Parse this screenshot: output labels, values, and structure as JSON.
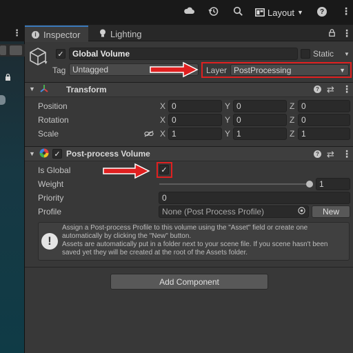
{
  "toolbar": {
    "layout_label": "Layout"
  },
  "tabs": {
    "inspector": "Inspector",
    "lighting": "Lighting"
  },
  "object": {
    "name": "Global Volume",
    "static_label": "Static",
    "tag_label": "Tag",
    "tag_value": "Untagged",
    "layer_label": "Layer",
    "layer_value": "PostProcessing"
  },
  "transform": {
    "title": "Transform",
    "position_label": "Position",
    "rotation_label": "Rotation",
    "scale_label": "Scale",
    "position": {
      "x": "0",
      "y": "0",
      "z": "0"
    },
    "rotation": {
      "x": "0",
      "y": "0",
      "z": "0"
    },
    "scale": {
      "x": "1",
      "y": "1",
      "z": "1"
    },
    "axes": {
      "x": "X",
      "y": "Y",
      "z": "Z"
    }
  },
  "ppv": {
    "title": "Post-process Volume",
    "is_global_label": "Is Global",
    "weight_label": "Weight",
    "weight_value": "1",
    "priority_label": "Priority",
    "priority_value": "0",
    "profile_label": "Profile",
    "profile_value": "None (Post Process Profile)",
    "new_label": "New",
    "help_line1": "Assign a Post-process Profile to this volume using the \"Asset\" field or create one automatically by clicking the \"New\" button.",
    "help_line2": "Assets are automatically put in a folder next to your scene file. If you scene hasn't been saved yet they will be created at the root of the Assets folder."
  },
  "add_component_label": "Add Component",
  "colors": {
    "highlight": "#e02020",
    "accent": "#3a79bb"
  }
}
